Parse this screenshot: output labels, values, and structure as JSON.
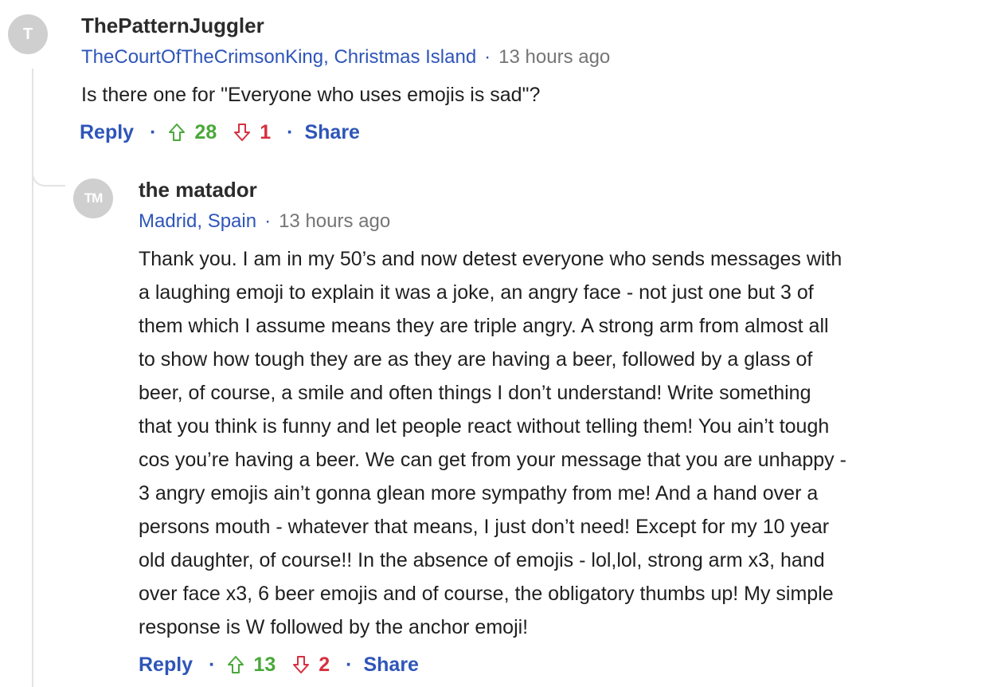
{
  "comments": [
    {
      "avatar_initials": "T",
      "author": "ThePatternJuggler",
      "location": "TheCourtOfTheCrimsonKing, Christmas Island",
      "time": "13 hours ago",
      "text_lines": [
        "Is there one for \"Everyone who uses emojis is sad\"?"
      ],
      "reply_label": "Reply",
      "upvotes": "28",
      "downvotes": "1",
      "share_label": "Share"
    },
    {
      "avatar_initials": "TM",
      "author": "the matador",
      "location": "Madrid, Spain",
      "time": "13 hours ago",
      "text_lines": [
        "Thank you. I am in my 50’s and now detest everyone who sends messages with",
        "a laughing emoji to explain it was a joke, an angry face - not just one but 3 of",
        "them which I assume means they are triple angry. A strong arm from almost all",
        "to show how tough they are as they are having a beer, followed by a glass of",
        "beer,  of course, a smile and often things I don’t understand! Write something",
        "that you think is funny and let people react without telling them! You ain’t tough",
        "cos you’re having a beer. We can get from your message that you are unhappy -",
        "3 angry emojis ain’t gonna glean more sympathy from me! And a hand over a",
        "persons mouth - whatever that means, I just don’t need! Except for my 10 year",
        "old daughter, of course!! In the absence of emojis - lol,lol, strong arm x3, hand",
        "over face x3, 6 beer emojis and of course, the obligatory thumbs up! My simple",
        "response is W followed by the anchor emoji!"
      ],
      "reply_label": "Reply",
      "upvotes": "13",
      "downvotes": "2",
      "share_label": "Share"
    }
  ],
  "separator": "·",
  "colors": {
    "link": "#2e55b8",
    "upvote": "#4aa83a",
    "downvote": "#d6303f",
    "muted": "#757575",
    "avatar": "#cfcfcf",
    "thread_line": "#e3e3e3"
  },
  "icons": {
    "upvote": "arrow-up-icon",
    "downvote": "arrow-down-icon"
  }
}
